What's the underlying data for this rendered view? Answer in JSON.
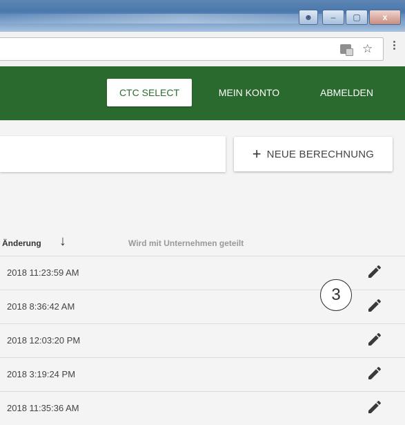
{
  "window": {
    "controls": {
      "minimize": "–",
      "maximize": "▢",
      "close": "x"
    }
  },
  "header": {
    "nav": [
      {
        "label": "CTC SELECT"
      },
      {
        "label": "MEIN KONTO"
      },
      {
        "label": "ABMELDEN"
      }
    ]
  },
  "toolbar": {
    "new_button_label": "NEUE BERECHNUNG",
    "new_button_icon": "+"
  },
  "table": {
    "columns": {
      "date": "Änderung",
      "shared": "Wird mit Unternehmen geteilt"
    },
    "rows": [
      {
        "date": "2018 11:23:59 AM"
      },
      {
        "date": "2018 8:36:42 AM"
      },
      {
        "date": "2018 12:03:20 PM"
      },
      {
        "date": "2018 3:19:24 PM"
      },
      {
        "date": "2018 11:35:36 AM"
      }
    ]
  },
  "annotation": {
    "number": "3"
  },
  "colors": {
    "brand_green": "#2b6a2e",
    "background": "#f4f4f4"
  }
}
